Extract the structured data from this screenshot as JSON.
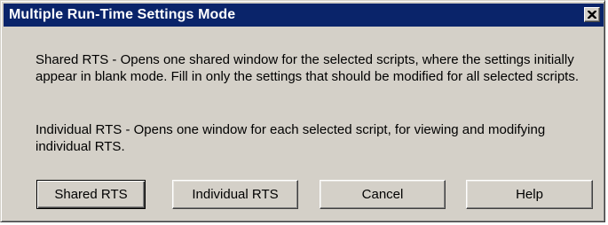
{
  "dialog": {
    "title": "Multiple Run-Time Settings Mode",
    "colors": {
      "titlebar": "#0a246a",
      "face": "#d4d0c8",
      "title_text": "#ffffff"
    },
    "close_icon": "close-icon"
  },
  "message": {
    "shared_text": "Shared RTS - Opens one shared window for the selected scripts, where the settings initially appear in blank mode. Fill in only the settings that should be modified for all selected scripts.",
    "individual_text": "Individual RTS - Opens one window for each selected script, for viewing and modifying individual RTS."
  },
  "buttons": {
    "shared": "Shared RTS",
    "individual": "Individual RTS",
    "cancel": "Cancel",
    "help": "Help"
  }
}
